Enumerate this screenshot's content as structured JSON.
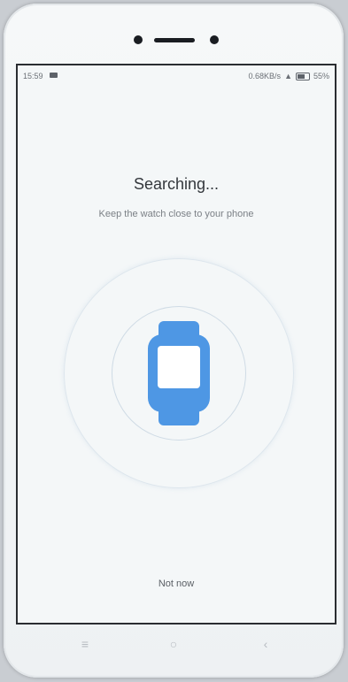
{
  "status_bar": {
    "time": "15:59",
    "network_speed": "0.68KB/s",
    "battery": "55%"
  },
  "screen": {
    "title": "Searching...",
    "subtitle": "Keep the watch close to your phone",
    "dismiss_label": "Not now"
  },
  "nav_bar": {
    "menu_icon": "≡",
    "home_icon": "○",
    "back_icon": "‹"
  },
  "colors": {
    "accent": "#4e97e4",
    "background": "#f4f7f8"
  },
  "icons": [
    "camera-icon",
    "speaker-icon",
    "video-icon",
    "battery-icon",
    "watch-icon",
    "menu-icon",
    "home-icon",
    "back-icon"
  ]
}
